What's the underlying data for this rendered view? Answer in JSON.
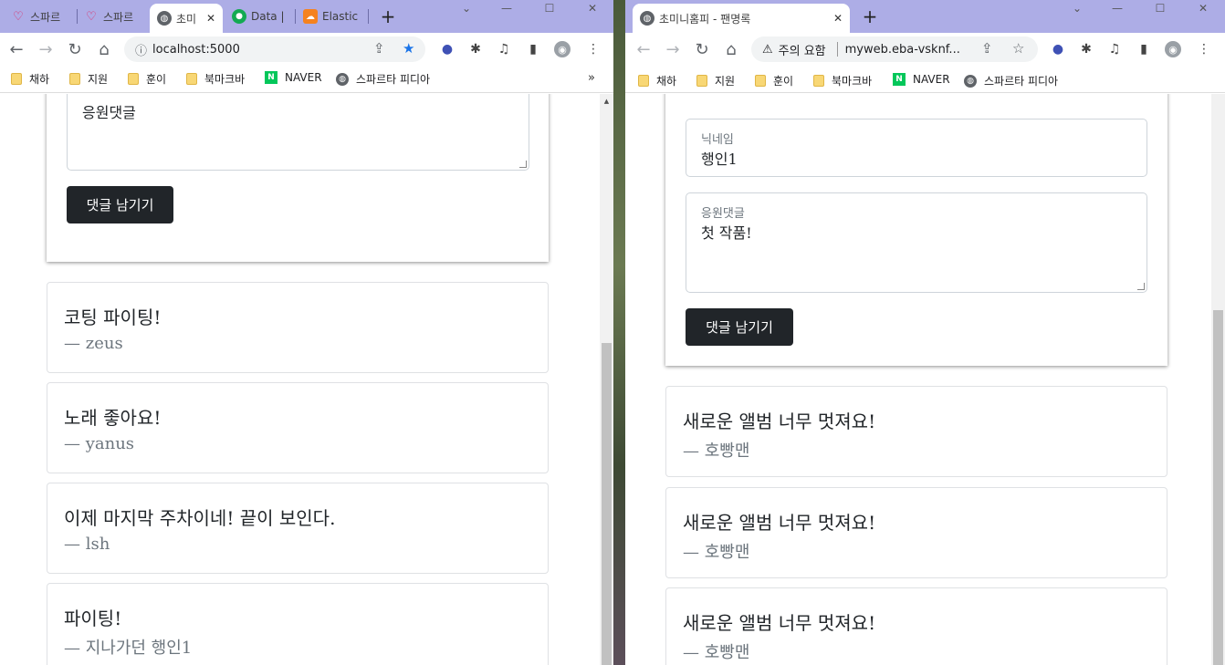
{
  "left": {
    "tabs": [
      {
        "title": "스파르",
        "icon": "heart-icon"
      },
      {
        "title": "스파르",
        "icon": "heart-icon"
      },
      {
        "title": "초미",
        "icon": "globe-icon"
      },
      {
        "title": "Data |",
        "icon": "leaf-icon"
      },
      {
        "title": "Elastic",
        "icon": "cloud-icon"
      }
    ],
    "url": "localhost:5000",
    "form": {
      "comment_value": "응원댓글",
      "submit_label": "댓글 남기기"
    },
    "comments": [
      {
        "message": "코팅 파이팅!",
        "name": "— zeus"
      },
      {
        "message": "노래 좋아요!",
        "name": "— yanus"
      },
      {
        "message": "이제 마지막 주차이네! 끝이 보인다.",
        "name": "— lsh"
      },
      {
        "message": "파이팅!",
        "name": "— 지나가던 행인1"
      }
    ]
  },
  "right": {
    "tab_title": "초미니홈피 - 팬명록",
    "security_label": "주의 요함",
    "url": "myweb.eba-vsknf...",
    "form": {
      "nickname_label": "닉네임",
      "nickname_value": "행인1",
      "comment_label": "응원댓글",
      "comment_value": "첫 작품!",
      "submit_label": "댓글 남기기"
    },
    "comments": [
      {
        "message": "새로운 앨범 너무 멋져요!",
        "name": "— 호빵맨"
      },
      {
        "message": "새로운 앨범 너무 멋져요!",
        "name": "— 호빵맨"
      },
      {
        "message": "새로운 앨범 너무 멋져요!",
        "name": "— 호빵맨"
      }
    ]
  },
  "bookmarks": [
    {
      "label": "채하",
      "icon": "folder-icon"
    },
    {
      "label": "지원",
      "icon": "folder-icon"
    },
    {
      "label": "훈이",
      "icon": "folder-icon"
    },
    {
      "label": "북마크바",
      "icon": "folder-icon"
    },
    {
      "label": "NAVER",
      "icon": "naver-icon"
    },
    {
      "label": "스파르타 피디아",
      "icon": "globe-icon"
    }
  ],
  "naver_glyph": "N",
  "more_glyph": "»",
  "colors": {
    "tabstrip": "#adade6",
    "button_dark": "#212529",
    "muted_text": "#6c757d"
  }
}
